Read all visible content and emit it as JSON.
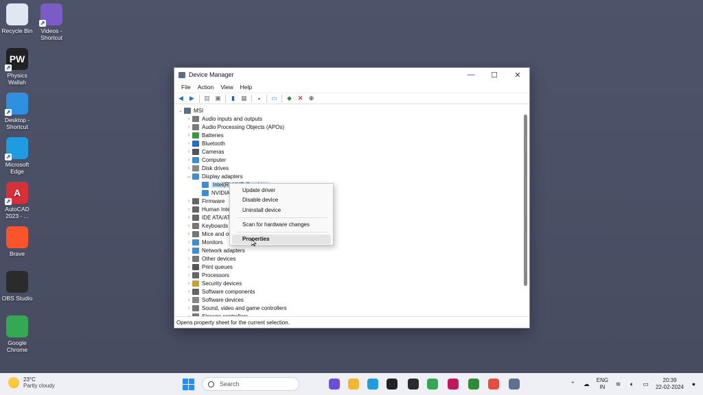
{
  "desktop_icons": [
    {
      "label": "Recycle Bin",
      "icon": "recycle-bin-icon",
      "color": "#dfe8f2"
    },
    {
      "label": "Videos - Shortcut",
      "icon": "videos-folder-icon",
      "color": "#7b5cc6"
    },
    {
      "label": "Physics Wallah",
      "icon": "pw-app-icon",
      "color": "#222222",
      "glyph": "PW"
    },
    {
      "label": "Desktop - Shortcut",
      "icon": "desktop-folder-icon",
      "color": "#2f8fe0"
    },
    {
      "label": "Microsoft Edge",
      "icon": "edge-icon",
      "color": "#1f9be0"
    },
    {
      "label": "AutoCAD 2023 - ...",
      "icon": "autocad-icon",
      "color": "#d82f38",
      "glyph": "A"
    },
    {
      "label": "Brave",
      "icon": "brave-icon",
      "color": "#fb542b"
    },
    {
      "label": "OBS Studio",
      "icon": "obs-icon",
      "color": "#2b2b2b"
    },
    {
      "label": "Google Chrome",
      "icon": "chrome-icon",
      "color": "#34a853"
    }
  ],
  "window": {
    "title": "Device Manager",
    "minimize": "—",
    "maximize": "☐",
    "close": "✕",
    "menu": [
      "File",
      "Action",
      "View",
      "Help"
    ],
    "status": "Opens property sheet for the current selection."
  },
  "tree": {
    "root": "MSI",
    "items": [
      {
        "label": "Audio inputs and outputs",
        "arrow": "›",
        "color": "#7a7a7a"
      },
      {
        "label": "Audio Processing Objects (APOs)",
        "arrow": "›",
        "color": "#7a7a7a"
      },
      {
        "label": "Batteries",
        "arrow": "›",
        "color": "#3a9a3a"
      },
      {
        "label": "Bluetooth",
        "arrow": "›",
        "color": "#1e6fd0"
      },
      {
        "label": "Cameras",
        "arrow": "›",
        "color": "#555555"
      },
      {
        "label": "Computer",
        "arrow": "›",
        "color": "#3b8fd6"
      },
      {
        "label": "Disk drives",
        "arrow": "›",
        "color": "#888888"
      },
      {
        "label": "Display adapters",
        "arrow": "⌄",
        "color": "#3b8fd6"
      },
      {
        "label": "Intel(R) UHD Graphics",
        "arrow": "",
        "color": "#3b8fd6",
        "child": true,
        "selected": true
      },
      {
        "label": "NVIDIA GeForce",
        "arrow": "",
        "color": "#3b8fd6",
        "child": true
      },
      {
        "label": "Firmware",
        "arrow": "›",
        "color": "#666666"
      },
      {
        "label": "Human Interface Devices",
        "arrow": "›",
        "color": "#666666"
      },
      {
        "label": "IDE ATA/ATAPI controllers",
        "arrow": "›",
        "color": "#666666"
      },
      {
        "label": "Keyboards",
        "arrow": "›",
        "color": "#777777"
      },
      {
        "label": "Mice and other pointing devices",
        "arrow": "›",
        "color": "#777777"
      },
      {
        "label": "Monitors",
        "arrow": "›",
        "color": "#3b8fd6"
      },
      {
        "label": "Network adapters",
        "arrow": "›",
        "color": "#3b8fd6"
      },
      {
        "label": "Other devices",
        "arrow": "›",
        "color": "#777777"
      },
      {
        "label": "Print queues",
        "arrow": "›",
        "color": "#555555"
      },
      {
        "label": "Processors",
        "arrow": "›",
        "color": "#666666"
      },
      {
        "label": "Security devices",
        "arrow": "›",
        "color": "#c9a227"
      },
      {
        "label": "Software components",
        "arrow": "›",
        "color": "#666666"
      },
      {
        "label": "Software devices",
        "arrow": "›",
        "color": "#888888"
      },
      {
        "label": "Sound, video and game controllers",
        "arrow": "›",
        "color": "#777777"
      },
      {
        "label": "Storage controllers",
        "arrow": "›",
        "color": "#777777"
      }
    ]
  },
  "context_menu": {
    "items": [
      "Update driver",
      "Disable device",
      "Uninstall device",
      "Scan for hardware changes",
      "Properties"
    ]
  },
  "taskbar": {
    "weather_temp": "23°C",
    "weather_desc": "Partly cloudy",
    "search_placeholder": "Search",
    "lang_line1": "ENG",
    "lang_line2": "IN",
    "time": "20:39",
    "date": "22-02-2024",
    "apps": [
      {
        "icon": "copilot-icon",
        "color": "#6b4fd8"
      },
      {
        "icon": "file-explorer-icon",
        "color": "#f2b630"
      },
      {
        "icon": "edge-icon",
        "color": "#1f9be0"
      },
      {
        "icon": "pw-app-icon",
        "color": "#222222"
      },
      {
        "icon": "obs-icon",
        "color": "#2b2b2b"
      },
      {
        "icon": "chrome-icon",
        "color": "#34a853"
      },
      {
        "icon": "app-icon",
        "color": "#c2185b"
      },
      {
        "icon": "xbox-icon",
        "color": "#2e8b3a"
      },
      {
        "icon": "chrome-profile-icon",
        "color": "#e84c3d"
      },
      {
        "icon": "device-manager-icon",
        "color": "#607090"
      }
    ]
  }
}
